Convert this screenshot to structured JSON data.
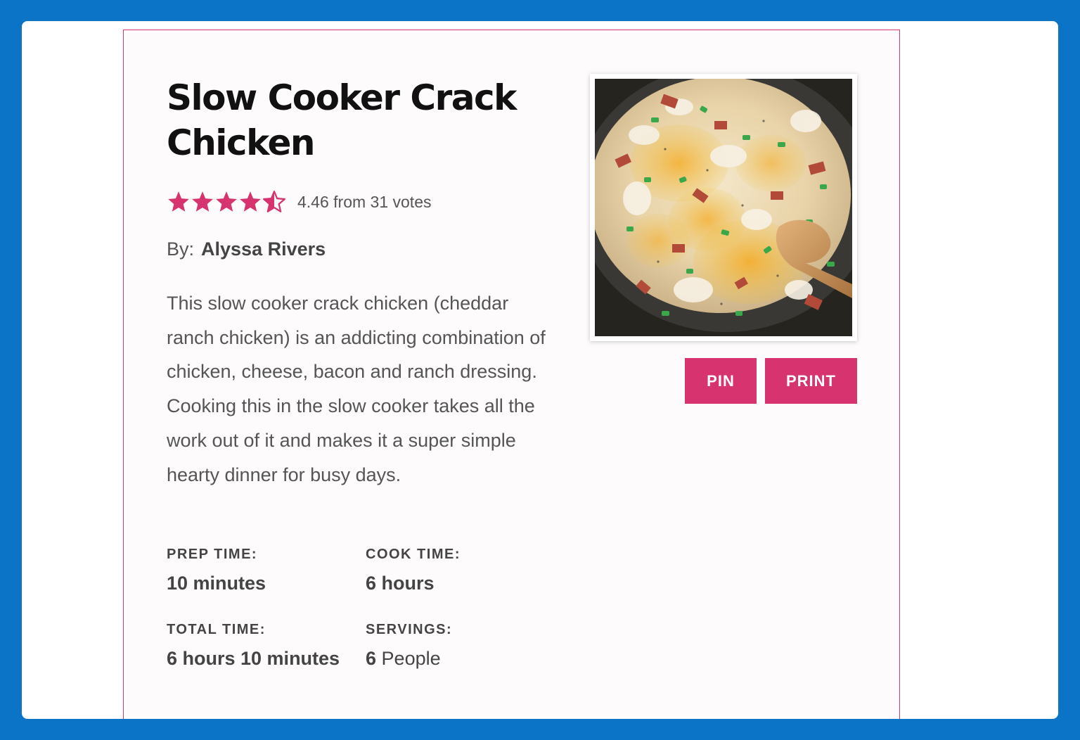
{
  "recipe": {
    "title": "Slow Cooker Crack Chicken",
    "rating": {
      "value": 4.46,
      "stars_max": 5,
      "text": "4.46 from 31 votes",
      "color": "#d6336f"
    },
    "author_prefix": "By:",
    "author_name": "Alyssa Rivers",
    "description": "This slow cooker crack chicken (cheddar ranch chicken) is an addicting combination of chicken, cheese, bacon and ranch dressing. Cooking this in the slow cooker takes all the work out of it and makes it a super simple hearty dinner for busy days.",
    "times": {
      "prep_label": "PREP TIME:",
      "prep_value": "10 minutes",
      "cook_label": "COOK TIME:",
      "cook_value": "6 hours",
      "total_label": "TOTAL TIME:",
      "total_value": "6 hours 10 minutes",
      "servings_label": "SERVINGS:",
      "servings_number": "6",
      "servings_unit": "People"
    },
    "buttons": {
      "pin": "PIN",
      "print": "PRINT"
    }
  },
  "colors": {
    "background": "#0b74c6",
    "accent": "#d6336f"
  }
}
